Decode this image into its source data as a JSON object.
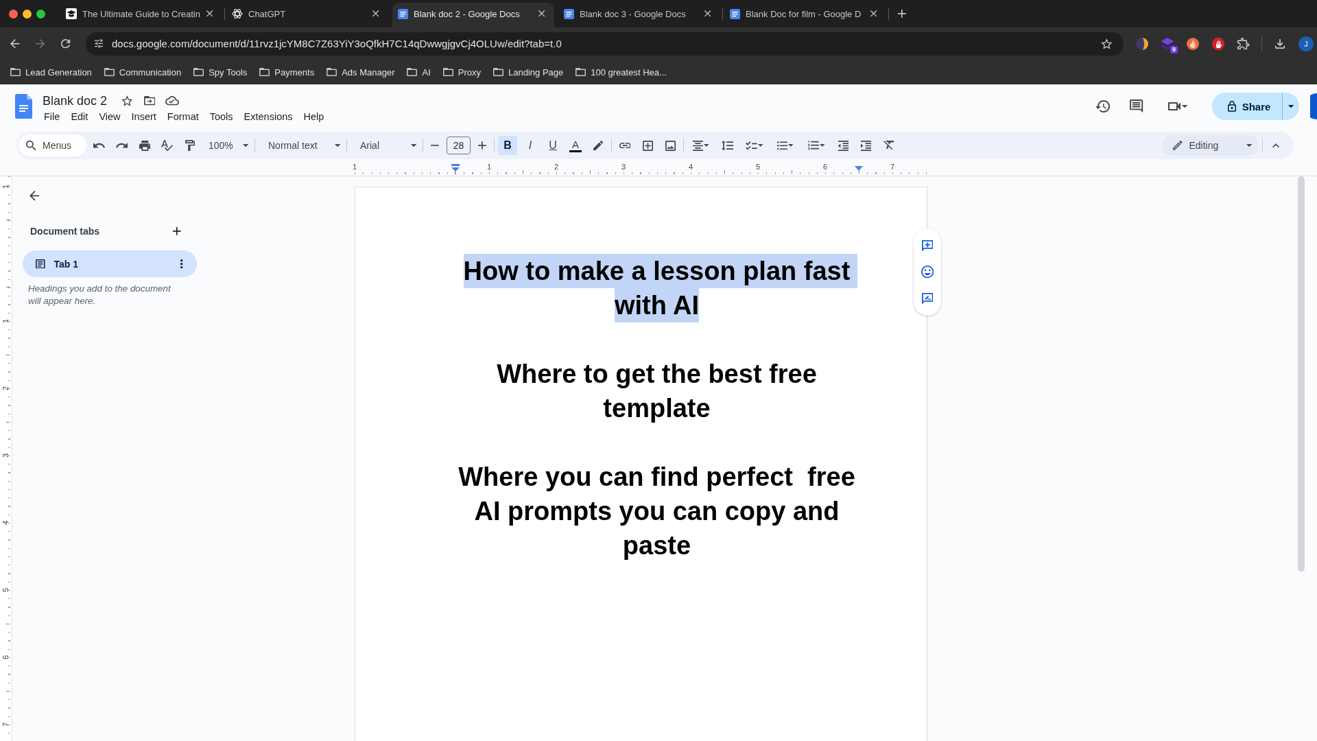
{
  "browser": {
    "tabs": [
      {
        "title": "The Ultimate Guide to Creatin",
        "kind": "guide",
        "selected": false
      },
      {
        "title": "ChatGPT",
        "kind": "chat",
        "selected": false
      },
      {
        "title": "Blank doc 2 - Google Docs",
        "kind": "docs",
        "selected": true
      },
      {
        "title": "Blank doc 3 - Google Docs",
        "kind": "docs",
        "selected": false
      },
      {
        "title": "Blank Doc for film - Google D",
        "kind": "docs",
        "selected": false
      }
    ],
    "nav_buttons": [
      {
        "kind": "back",
        "disabled": false
      },
      {
        "kind": "forward",
        "disabled": true
      },
      {
        "kind": "reload",
        "disabled": false
      }
    ],
    "address": "docs.google.com/document/d/11rvz1jcYM8C7Z63YiY3oQfkH7C14qDwwgjgvCj4OLUw/edit?tab=t.0",
    "extensions": [
      {
        "kind": "crescent"
      },
      {
        "kind": "stack",
        "badge": "9"
      },
      {
        "kind": "flame"
      },
      {
        "kind": "hand"
      },
      {
        "kind": "puzzle"
      }
    ],
    "profile": "J",
    "bookmarks": [
      "Lead Generation",
      "Communication",
      "Spy Tools",
      "Payments",
      "Ads Manager",
      "AI",
      "Proxy",
      "Landing Page",
      "100 greatest Hea..."
    ]
  },
  "docs": {
    "title": "Blank doc 2",
    "menus": [
      "File",
      "Edit",
      "View",
      "Insert",
      "Format",
      "Tools",
      "Extensions",
      "Help"
    ],
    "share": "Share",
    "toolbar": {
      "search": {
        "placeholder": "Menus"
      },
      "zoom": "100%",
      "style": "Normal text",
      "font": "Arial",
      "font_size": "28",
      "format_buttons": [
        {
          "kind": "bold",
          "label": "B",
          "on": true
        },
        {
          "kind": "italic",
          "label": "I",
          "on": false
        },
        {
          "kind": "underline",
          "label": "U",
          "on": false
        }
      ],
      "text_color": "A",
      "mode": "Editing"
    },
    "ruler": [
      "1",
      "1",
      "2",
      "3",
      "4",
      "5",
      "6",
      "7"
    ],
    "vertical_ruler": [
      "1",
      "1",
      "2",
      "3",
      "4",
      "5",
      "6",
      "7"
    ],
    "sidebar": {
      "heading": "Document tabs",
      "tabs": [
        {
          "label": "Tab 1",
          "selected": true
        }
      ],
      "hint": "Headings you add to the document will appear here."
    },
    "paragraphs": [
      {
        "text": "How to make a lesson plan fast with AI",
        "selected": true
      },
      {
        "text": "Where to get the best free template",
        "selected": false
      },
      {
        "text": "Where you can find perfect  free AI prompts you can copy and paste",
        "selected": false
      }
    ]
  }
}
